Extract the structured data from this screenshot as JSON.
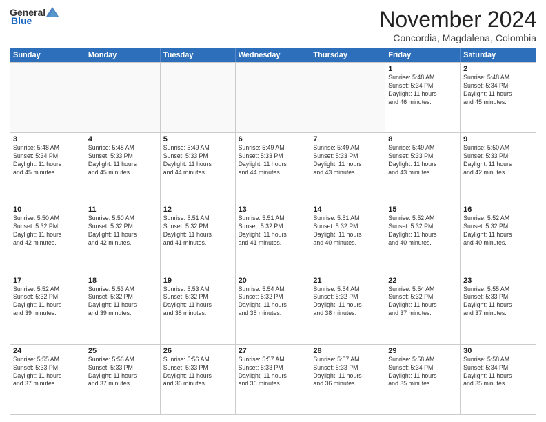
{
  "header": {
    "logo_general": "General",
    "logo_blue": "Blue",
    "month_title": "November 2024",
    "location": "Concordia, Magdalena, Colombia"
  },
  "weekdays": [
    "Sunday",
    "Monday",
    "Tuesday",
    "Wednesday",
    "Thursday",
    "Friday",
    "Saturday"
  ],
  "rows": [
    [
      {
        "day": "",
        "info": "",
        "empty": true
      },
      {
        "day": "",
        "info": "",
        "empty": true
      },
      {
        "day": "",
        "info": "",
        "empty": true
      },
      {
        "day": "",
        "info": "",
        "empty": true
      },
      {
        "day": "",
        "info": "",
        "empty": true
      },
      {
        "day": "1",
        "info": "Sunrise: 5:48 AM\nSunset: 5:34 PM\nDaylight: 11 hours\nand 46 minutes.",
        "empty": false
      },
      {
        "day": "2",
        "info": "Sunrise: 5:48 AM\nSunset: 5:34 PM\nDaylight: 11 hours\nand 45 minutes.",
        "empty": false
      }
    ],
    [
      {
        "day": "3",
        "info": "Sunrise: 5:48 AM\nSunset: 5:34 PM\nDaylight: 11 hours\nand 45 minutes.",
        "empty": false
      },
      {
        "day": "4",
        "info": "Sunrise: 5:48 AM\nSunset: 5:33 PM\nDaylight: 11 hours\nand 45 minutes.",
        "empty": false
      },
      {
        "day": "5",
        "info": "Sunrise: 5:49 AM\nSunset: 5:33 PM\nDaylight: 11 hours\nand 44 minutes.",
        "empty": false
      },
      {
        "day": "6",
        "info": "Sunrise: 5:49 AM\nSunset: 5:33 PM\nDaylight: 11 hours\nand 44 minutes.",
        "empty": false
      },
      {
        "day": "7",
        "info": "Sunrise: 5:49 AM\nSunset: 5:33 PM\nDaylight: 11 hours\nand 43 minutes.",
        "empty": false
      },
      {
        "day": "8",
        "info": "Sunrise: 5:49 AM\nSunset: 5:33 PM\nDaylight: 11 hours\nand 43 minutes.",
        "empty": false
      },
      {
        "day": "9",
        "info": "Sunrise: 5:50 AM\nSunset: 5:33 PM\nDaylight: 11 hours\nand 42 minutes.",
        "empty": false
      }
    ],
    [
      {
        "day": "10",
        "info": "Sunrise: 5:50 AM\nSunset: 5:32 PM\nDaylight: 11 hours\nand 42 minutes.",
        "empty": false
      },
      {
        "day": "11",
        "info": "Sunrise: 5:50 AM\nSunset: 5:32 PM\nDaylight: 11 hours\nand 42 minutes.",
        "empty": false
      },
      {
        "day": "12",
        "info": "Sunrise: 5:51 AM\nSunset: 5:32 PM\nDaylight: 11 hours\nand 41 minutes.",
        "empty": false
      },
      {
        "day": "13",
        "info": "Sunrise: 5:51 AM\nSunset: 5:32 PM\nDaylight: 11 hours\nand 41 minutes.",
        "empty": false
      },
      {
        "day": "14",
        "info": "Sunrise: 5:51 AM\nSunset: 5:32 PM\nDaylight: 11 hours\nand 40 minutes.",
        "empty": false
      },
      {
        "day": "15",
        "info": "Sunrise: 5:52 AM\nSunset: 5:32 PM\nDaylight: 11 hours\nand 40 minutes.",
        "empty": false
      },
      {
        "day": "16",
        "info": "Sunrise: 5:52 AM\nSunset: 5:32 PM\nDaylight: 11 hours\nand 40 minutes.",
        "empty": false
      }
    ],
    [
      {
        "day": "17",
        "info": "Sunrise: 5:52 AM\nSunset: 5:32 PM\nDaylight: 11 hours\nand 39 minutes.",
        "empty": false
      },
      {
        "day": "18",
        "info": "Sunrise: 5:53 AM\nSunset: 5:32 PM\nDaylight: 11 hours\nand 39 minutes.",
        "empty": false
      },
      {
        "day": "19",
        "info": "Sunrise: 5:53 AM\nSunset: 5:32 PM\nDaylight: 11 hours\nand 38 minutes.",
        "empty": false
      },
      {
        "day": "20",
        "info": "Sunrise: 5:54 AM\nSunset: 5:32 PM\nDaylight: 11 hours\nand 38 minutes.",
        "empty": false
      },
      {
        "day": "21",
        "info": "Sunrise: 5:54 AM\nSunset: 5:32 PM\nDaylight: 11 hours\nand 38 minutes.",
        "empty": false
      },
      {
        "day": "22",
        "info": "Sunrise: 5:54 AM\nSunset: 5:32 PM\nDaylight: 11 hours\nand 37 minutes.",
        "empty": false
      },
      {
        "day": "23",
        "info": "Sunrise: 5:55 AM\nSunset: 5:33 PM\nDaylight: 11 hours\nand 37 minutes.",
        "empty": false
      }
    ],
    [
      {
        "day": "24",
        "info": "Sunrise: 5:55 AM\nSunset: 5:33 PM\nDaylight: 11 hours\nand 37 minutes.",
        "empty": false
      },
      {
        "day": "25",
        "info": "Sunrise: 5:56 AM\nSunset: 5:33 PM\nDaylight: 11 hours\nand 37 minutes.",
        "empty": false
      },
      {
        "day": "26",
        "info": "Sunrise: 5:56 AM\nSunset: 5:33 PM\nDaylight: 11 hours\nand 36 minutes.",
        "empty": false
      },
      {
        "day": "27",
        "info": "Sunrise: 5:57 AM\nSunset: 5:33 PM\nDaylight: 11 hours\nand 36 minutes.",
        "empty": false
      },
      {
        "day": "28",
        "info": "Sunrise: 5:57 AM\nSunset: 5:33 PM\nDaylight: 11 hours\nand 36 minutes.",
        "empty": false
      },
      {
        "day": "29",
        "info": "Sunrise: 5:58 AM\nSunset: 5:34 PM\nDaylight: 11 hours\nand 35 minutes.",
        "empty": false
      },
      {
        "day": "30",
        "info": "Sunrise: 5:58 AM\nSunset: 5:34 PM\nDaylight: 11 hours\nand 35 minutes.",
        "empty": false
      }
    ]
  ]
}
